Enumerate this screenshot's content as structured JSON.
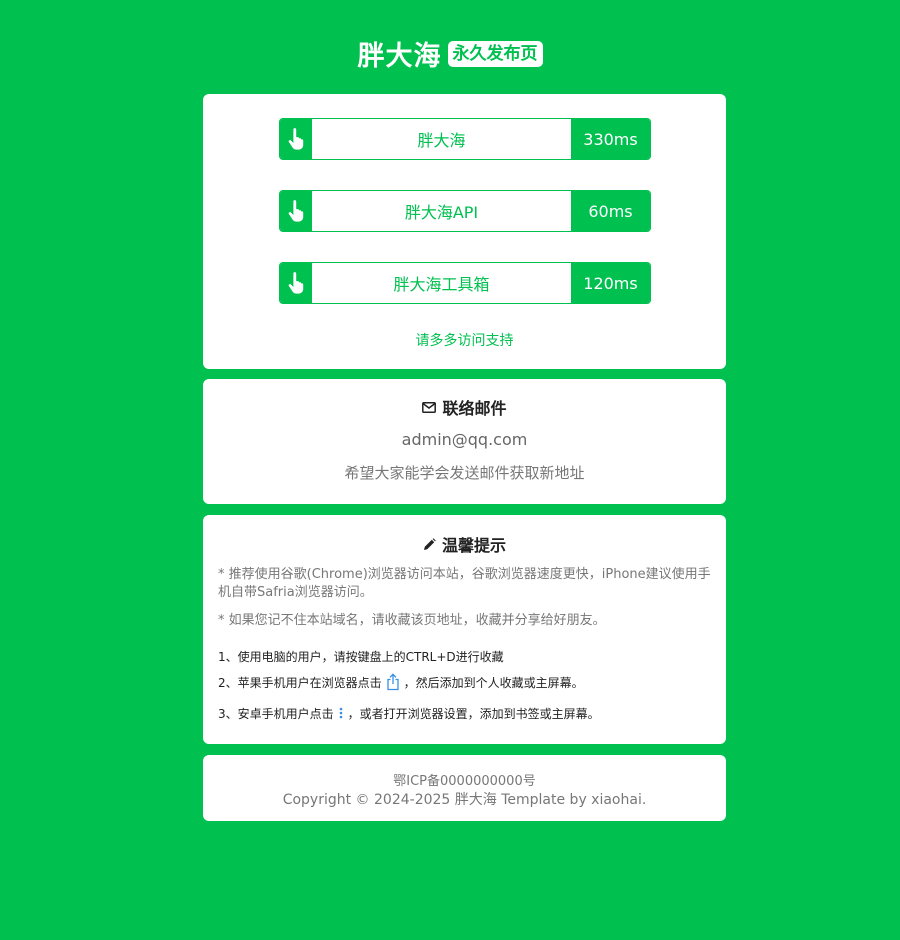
{
  "header": {
    "brand": "胖大海",
    "badge": "永久发布页"
  },
  "links": [
    {
      "label": "胖大海",
      "latency": "330ms",
      "icon": "hand-pointer-icon"
    },
    {
      "label": "胖大海API",
      "latency": "60ms",
      "icon": "hand-pointer-icon"
    },
    {
      "label": "胖大海工具箱",
      "latency": "120ms",
      "icon": "hand-pointer-icon"
    }
  ],
  "support_text": "请多多访问支持",
  "mail": {
    "icon": "envelope-icon",
    "title": "联络邮件",
    "address": "admin@qq.com",
    "note": "希望大家能学会发送邮件获取新地址"
  },
  "tips": {
    "icon": "pencil-icon",
    "title": "温馨提示",
    "notes": [
      "* 推荐使用谷歌(Chrome)浏览器访问本站，谷歌浏览器速度更快，iPhone建议使用手机自带Safria浏览器访问。",
      "* 如果您记不住本站域名，请收藏该页地址，收藏并分享给好朋友。"
    ],
    "step1": "1、使用电脑的用户，请按键盘上的CTRL+D进行收藏",
    "step2_before": "2、苹果手机用户在浏览器点击",
    "step2_after": "，然后添加到个人收藏或主屏幕。",
    "step3_before": "3、安卓手机用户点击",
    "step3_after": "，或者打开浏览器设置，添加到书签或主屏幕。"
  },
  "footer": {
    "icp": "鄂ICP备0000000000号",
    "copyright": "Copyright © 2024-2025 胖大海 Template by xiaohai."
  },
  "colors": {
    "background": "#00c050",
    "accent": "#00c050",
    "card": "#ffffff"
  }
}
